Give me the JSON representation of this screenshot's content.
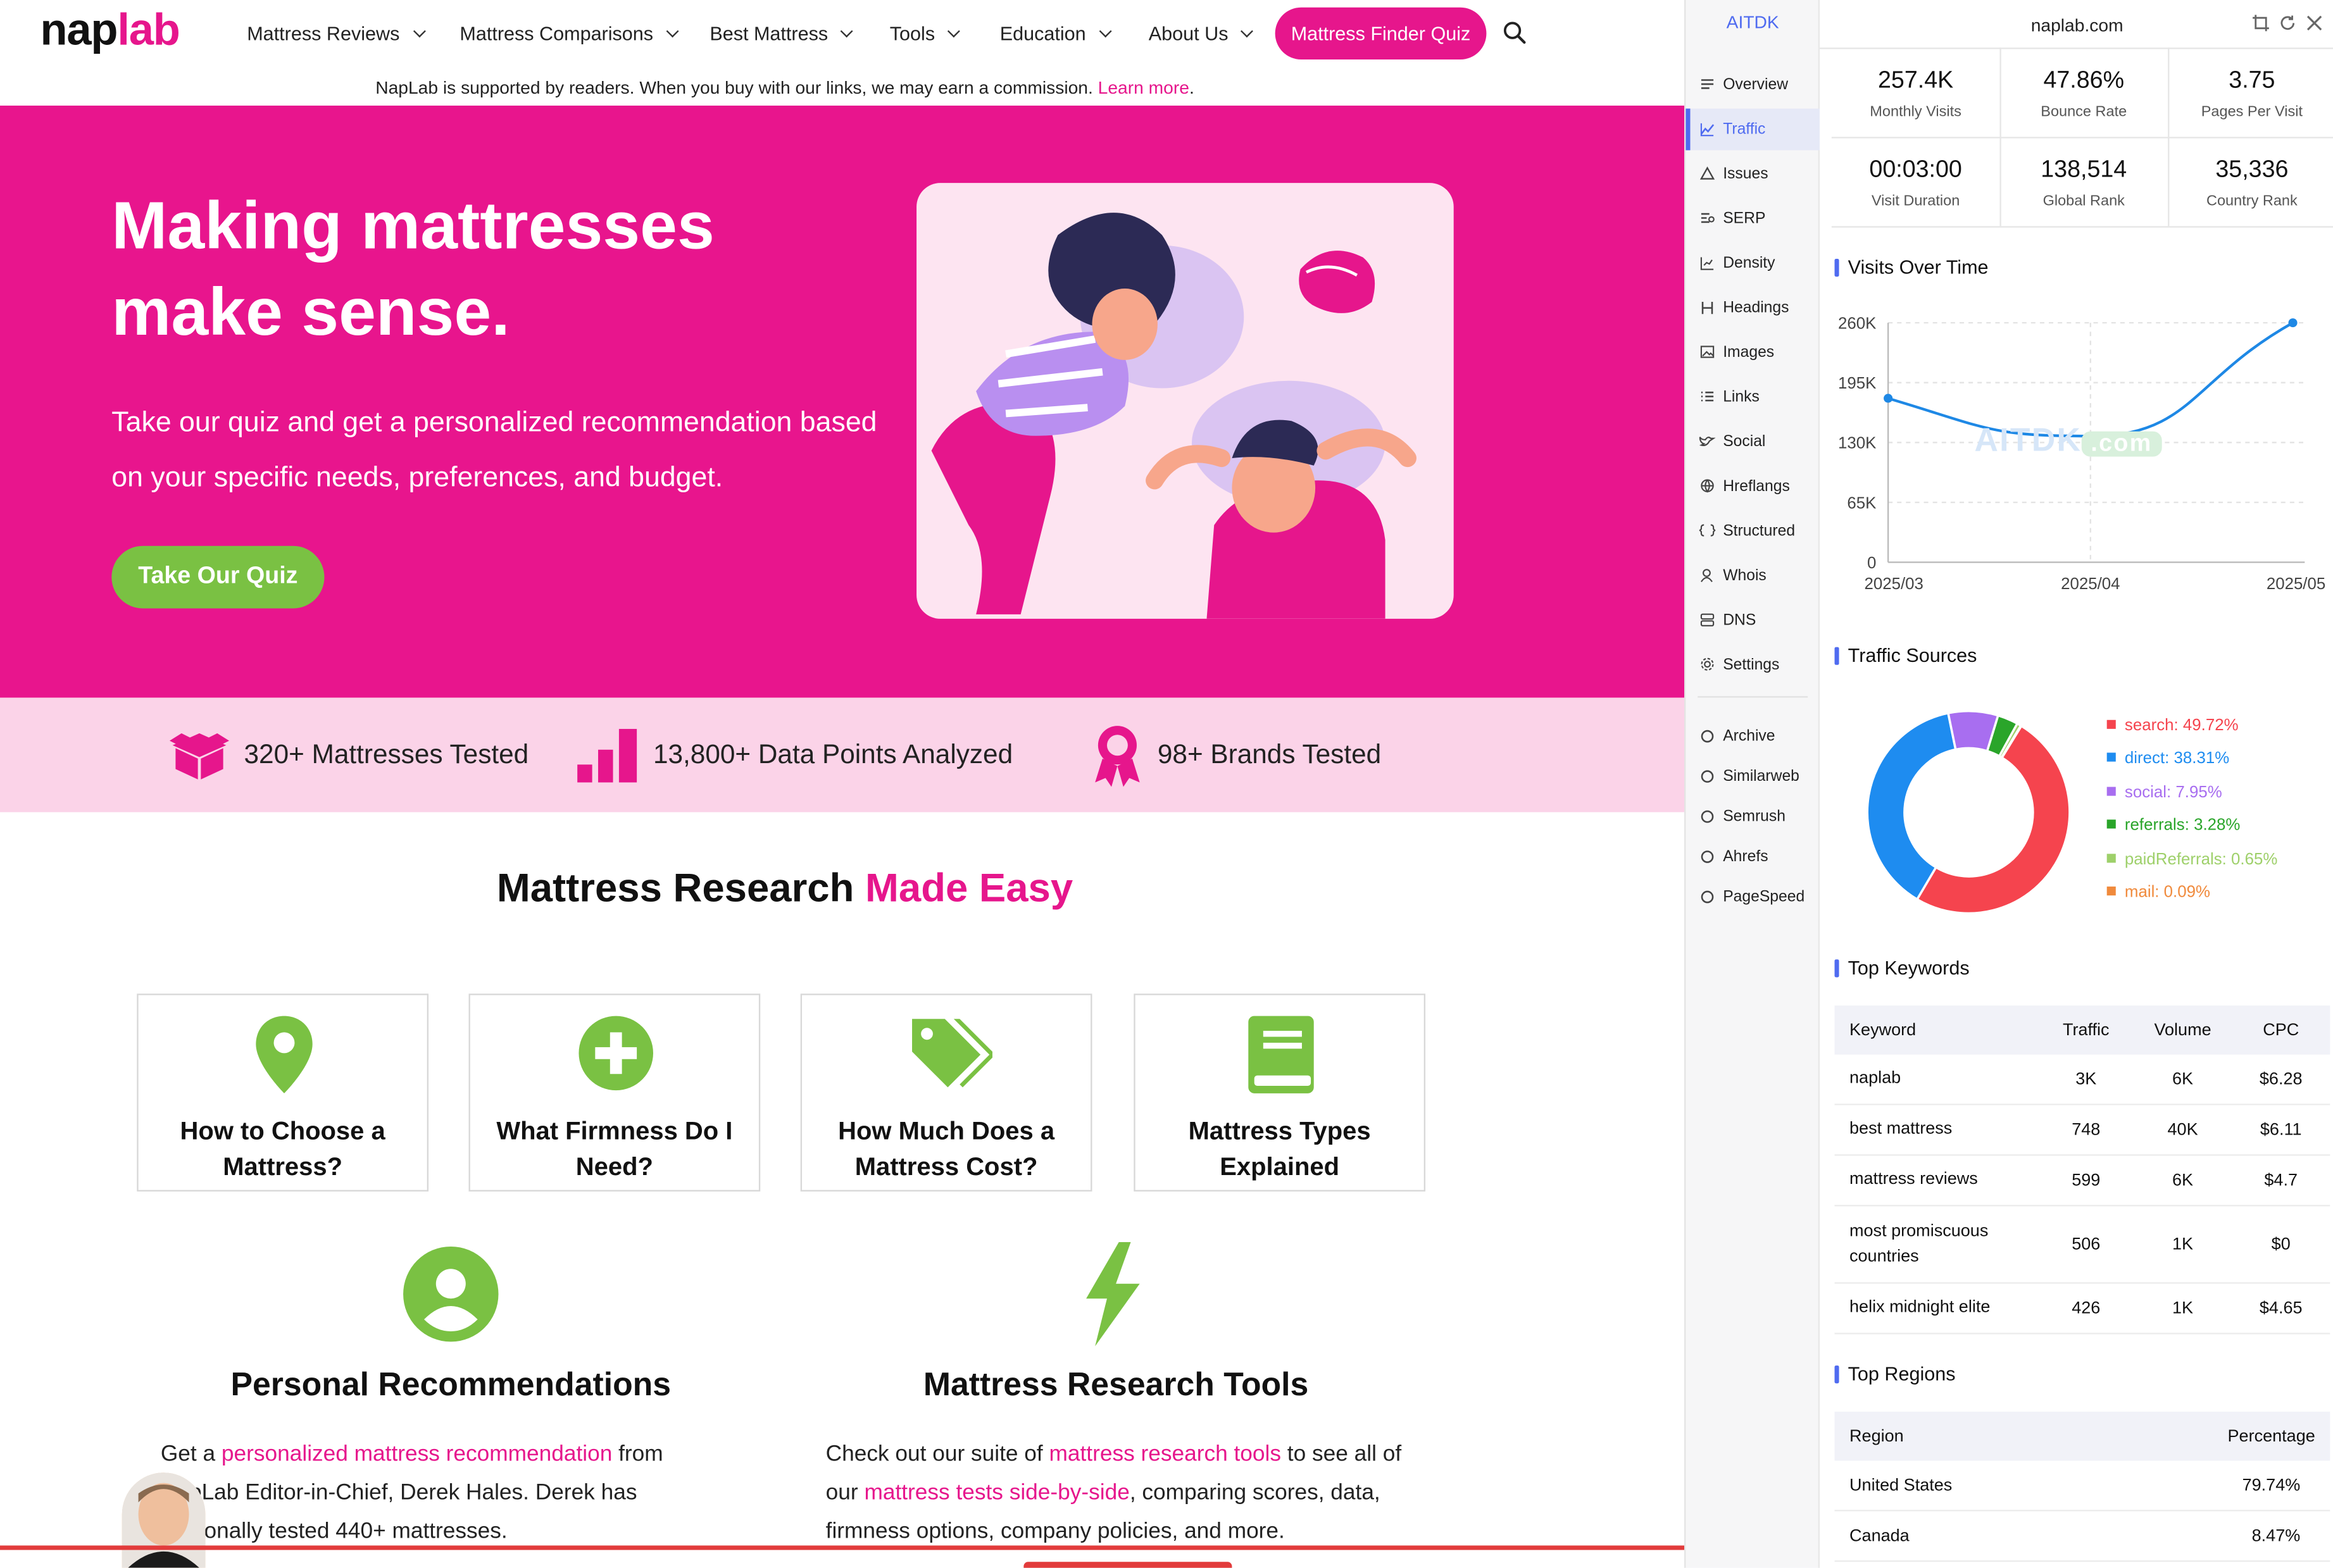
{
  "site": {
    "logo": {
      "part1": "nap",
      "part2": "lab"
    },
    "nav": [
      "Mattress Reviews",
      "Mattress Comparisons",
      "Best Mattress",
      "Tools",
      "Education",
      "About Us"
    ],
    "quiz_button": "Mattress Finder Quiz",
    "notice": {
      "text": "NapLab is supported by readers. When you buy with our links, we may earn a commission.",
      "link": "Learn more",
      "end": "."
    },
    "hero": {
      "title": "Making mattresses make sense.",
      "text": "Take our quiz and get a personalized recommendation based on your specific needs, preferences, and budget.",
      "button": "Take Our Quiz"
    },
    "stats": [
      "320+ Mattresses Tested",
      "13,800+ Data Points Analyzed",
      "98+ Brands Tested"
    ],
    "section": {
      "title": "Mattress Research",
      "highlight": "Made Easy"
    },
    "cards": [
      "How to Choose a Mattress?",
      "What Firmness Do I Need?",
      "How Much Does a Mattress Cost?",
      "Mattress Types Explained"
    ],
    "features": [
      {
        "title": "Personal Recommendations",
        "t1": "Get a ",
        "link": "personalized mattress recommendation",
        "t2": " from NapLab Editor-in-Chief, Derek Hales. Derek has personally tested 440+ mattresses."
      },
      {
        "title": "Mattress Research Tools",
        "t1": "Check out our suite of ",
        "link1": "mattress research tools",
        "t2": " to see all of our ",
        "link2": "mattress tests side-by-side",
        "t3": ", comparing scores, data, firmness options, company policies, and more."
      }
    ],
    "colors": {
      "brand": "#e8158d",
      "green": "#7ac143",
      "pink_light": "#fbd3e8"
    }
  },
  "ext": {
    "brand": "AITDK",
    "domain": "naplab.com",
    "nav": [
      "Overview",
      "Traffic",
      "Issues",
      "SERP",
      "Density",
      "Headings",
      "Images",
      "Links",
      "Social",
      "Hreflangs",
      "Structured",
      "Whois",
      "DNS",
      "Settings"
    ],
    "active_nav": "Traffic",
    "tools": [
      "Archive",
      "Similarweb",
      "Semrush",
      "Ahrefs",
      "PageSpeed"
    ],
    "metrics": [
      {
        "value": "257.4K",
        "label": "Monthly Visits"
      },
      {
        "value": "47.86%",
        "label": "Bounce Rate"
      },
      {
        "value": "3.75",
        "label": "Pages Per Visit"
      },
      {
        "value": "00:03:00",
        "label": "Visit Duration"
      },
      {
        "value": "138,514",
        "label": "Global Rank"
      },
      {
        "value": "35,336",
        "label": "Country Rank"
      }
    ],
    "visits_title": "Visits Over Time",
    "watermark": {
      "a": "AITDK",
      "b": ".com"
    },
    "sources_title": "Traffic Sources",
    "keywords_title": "Top Keywords",
    "keywords_header": [
      "Keyword",
      "Traffic",
      "Volume",
      "CPC"
    ],
    "keywords": [
      [
        "naplab",
        "3K",
        "6K",
        "$6.28"
      ],
      [
        "best mattress",
        "748",
        "40K",
        "$6.11"
      ],
      [
        "mattress reviews",
        "599",
        "6K",
        "$4.7"
      ],
      [
        "most promiscuous countries",
        "506",
        "1K",
        "$0"
      ],
      [
        "helix midnight elite",
        "426",
        "1K",
        "$4.65"
      ]
    ],
    "regions_title": "Top Regions",
    "regions_header": [
      "Region",
      "Percentage"
    ],
    "regions": [
      [
        "United States",
        "79.74%"
      ],
      [
        "Canada",
        "8.47%"
      ]
    ],
    "accent": "#4f6bf0"
  },
  "chart_data": [
    {
      "type": "line",
      "title": "Visits Over Time",
      "x": [
        "2025/03",
        "2025/04",
        "2025/05"
      ],
      "series": [
        {
          "values": [
            178000,
            137000,
            260000
          ]
        }
      ],
      "yticks": [
        "0",
        "65K",
        "130K",
        "195K",
        "260K"
      ],
      "ylim": [
        0,
        260000
      ],
      "grid": true,
      "color": "#1e88e5"
    },
    {
      "type": "pie",
      "title": "Traffic Sources",
      "labels": [
        "search",
        "direct",
        "social",
        "referrals",
        "paidReferrals",
        "mail"
      ],
      "values": [
        49.72,
        38.31,
        7.95,
        3.28,
        0.65,
        0.09
      ],
      "display": [
        "search: 49.72%",
        "direct: 38.31%",
        "social: 7.95%",
        "referrals: 3.28%",
        "paidReferrals: 0.65%",
        "mail: 0.09%"
      ],
      "colors": [
        "#f5444e",
        "#1e8cf0",
        "#a86ef0",
        "#2aa52a",
        "#9ed06a",
        "#f08a3c"
      ],
      "legend": "right"
    }
  ]
}
